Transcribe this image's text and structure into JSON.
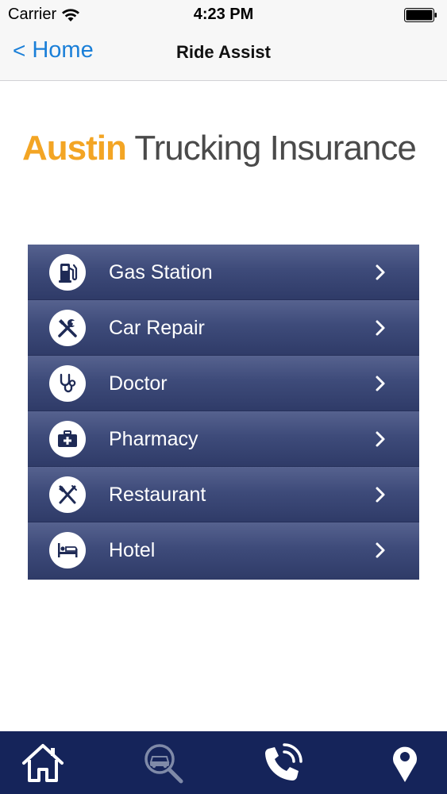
{
  "status_bar": {
    "carrier": "Carrier",
    "time": "4:23 PM"
  },
  "nav": {
    "back_label": "Home",
    "title": "Ride Assist"
  },
  "logo": {
    "part1": "Austin",
    "part2": " Trucking Insurance"
  },
  "menu": {
    "items": [
      {
        "label": "Gas Station",
        "icon": "gas-pump-icon"
      },
      {
        "label": "Car Repair",
        "icon": "tools-icon"
      },
      {
        "label": "Doctor",
        "icon": "stethoscope-icon"
      },
      {
        "label": "Pharmacy",
        "icon": "medical-kit-icon"
      },
      {
        "label": "Restaurant",
        "icon": "fork-knife-icon"
      },
      {
        "label": "Hotel",
        "icon": "bed-icon"
      }
    ]
  },
  "tab_bar": {
    "items": [
      "home-icon",
      "search-car-icon",
      "phone-icon",
      "location-pin-icon"
    ]
  },
  "colors": {
    "accent_blue": "#1a7fd8",
    "logo_orange": "#f3a524",
    "menu_navy": "#3e4b7a",
    "tab_bar_navy": "#15245a"
  }
}
